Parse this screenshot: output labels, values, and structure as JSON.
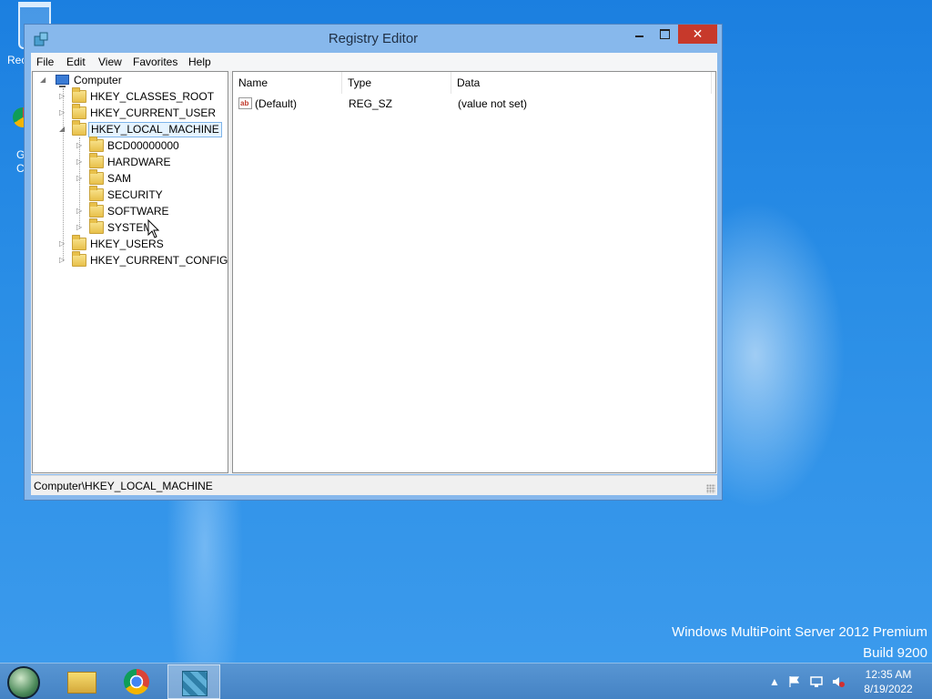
{
  "desktop": {
    "icons": [
      {
        "label": "Rec"
      },
      {
        "label": "G\nC"
      }
    ],
    "watermark": {
      "line1": "Windows MultiPoint Server 2012 Premium",
      "line2": "Build 9200"
    }
  },
  "window": {
    "title": "Registry Editor",
    "close_label": "✕",
    "menu": [
      "File",
      "Edit",
      "View",
      "Favorites",
      "Help"
    ],
    "tree": {
      "root": "Computer",
      "hives": [
        {
          "label": "HKEY_CLASSES_ROOT"
        },
        {
          "label": "HKEY_CURRENT_USER"
        },
        {
          "label": "HKEY_LOCAL_MACHINE",
          "selected": true,
          "expanded": true,
          "children": [
            "BCD00000000",
            "HARDWARE",
            "SAM",
            "SECURITY",
            "SOFTWARE",
            "SYSTEM"
          ]
        },
        {
          "label": "HKEY_USERS"
        },
        {
          "label": "HKEY_CURRENT_CONFIG"
        }
      ]
    },
    "list": {
      "columns": [
        "Name",
        "Type",
        "Data"
      ],
      "rows": [
        {
          "icon": "string-value-icon",
          "name": "(Default)",
          "type": "REG_SZ",
          "data": "(value not set)"
        }
      ]
    },
    "status_path": "Computer\\HKEY_LOCAL_MACHINE"
  },
  "taskbar": {
    "apps": [
      "start-orb-icon",
      "file-explorer-icon",
      "chrome-icon",
      "registry-editor-icon"
    ],
    "active_app": "registry-editor-icon",
    "tray_icons": [
      "show-hidden-icons",
      "action-center-flag-icon",
      "network-icon",
      "volume-muted-icon"
    ],
    "time": "12:35 AM",
    "date": "8/19/2022"
  }
}
